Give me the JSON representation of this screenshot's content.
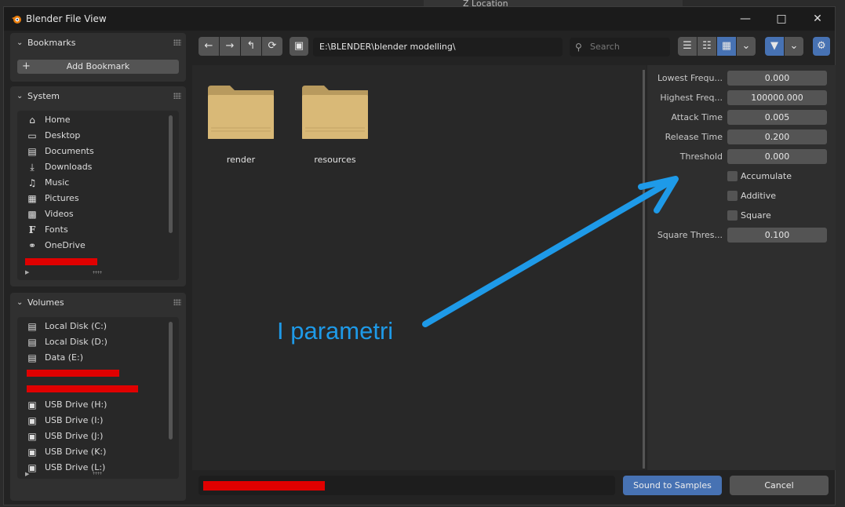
{
  "window": {
    "title": "Blender File View"
  },
  "background": {
    "label": "Z Location"
  },
  "sidebar": {
    "bookmarks": {
      "title": "Bookmarks",
      "add_label": "Add Bookmark"
    },
    "system": {
      "title": "System",
      "items": [
        {
          "label": "Home",
          "icon": "home-icon"
        },
        {
          "label": "Desktop",
          "icon": "desktop-icon"
        },
        {
          "label": "Documents",
          "icon": "documents-icon"
        },
        {
          "label": "Downloads",
          "icon": "downloads-icon"
        },
        {
          "label": "Music",
          "icon": "music-icon"
        },
        {
          "label": "Pictures",
          "icon": "pictures-icon"
        },
        {
          "label": "Videos",
          "icon": "videos-icon"
        },
        {
          "label": "Fonts",
          "icon": "fonts-icon"
        },
        {
          "label": "OneDrive",
          "icon": "globe-icon"
        }
      ]
    },
    "volumes": {
      "title": "Volumes",
      "items": [
        {
          "label": "Local Disk (C:)",
          "icon": "disk-icon"
        },
        {
          "label": "Local Disk (D:)",
          "icon": "disk-icon"
        },
        {
          "label": "Data (E:)",
          "icon": "disk-icon"
        },
        {
          "label": "USB Drive (H:)",
          "icon": "usb-icon"
        },
        {
          "label": "USB Drive (I:)",
          "icon": "usb-icon"
        },
        {
          "label": "USB Drive (J:)",
          "icon": "usb-icon"
        },
        {
          "label": "USB Drive (K:)",
          "icon": "usb-icon"
        },
        {
          "label": "USB Drive (L:)",
          "icon": "usb-icon"
        }
      ]
    }
  },
  "toolbar": {
    "path": "E:\\BLENDER\\blender modelling\\",
    "search_placeholder": "Search"
  },
  "files": [
    {
      "name": "render"
    },
    {
      "name": "resources"
    }
  ],
  "properties": {
    "fields": [
      {
        "label": "Lowest Frequ...",
        "value": "0.000"
      },
      {
        "label": "Highest Freq...",
        "value": "100000.000"
      },
      {
        "label": "Attack Time",
        "value": "0.005"
      },
      {
        "label": "Release Time",
        "value": "0.200"
      },
      {
        "label": "Threshold",
        "value": "0.000"
      }
    ],
    "checkboxes": [
      {
        "label": "Accumulate",
        "checked": false
      },
      {
        "label": "Additive",
        "checked": false
      },
      {
        "label": "Square",
        "checked": false
      }
    ],
    "square_threshold": {
      "label": "Square Thres...",
      "value": "0.100"
    }
  },
  "annotation": {
    "text": "I parametri",
    "color": "#1e9ae8"
  },
  "actions": {
    "confirm": "Sound to Samples",
    "cancel": "Cancel"
  },
  "colors": {
    "accent": "#4772b3",
    "redaction": "#e00000",
    "folder": "#d9b977"
  }
}
